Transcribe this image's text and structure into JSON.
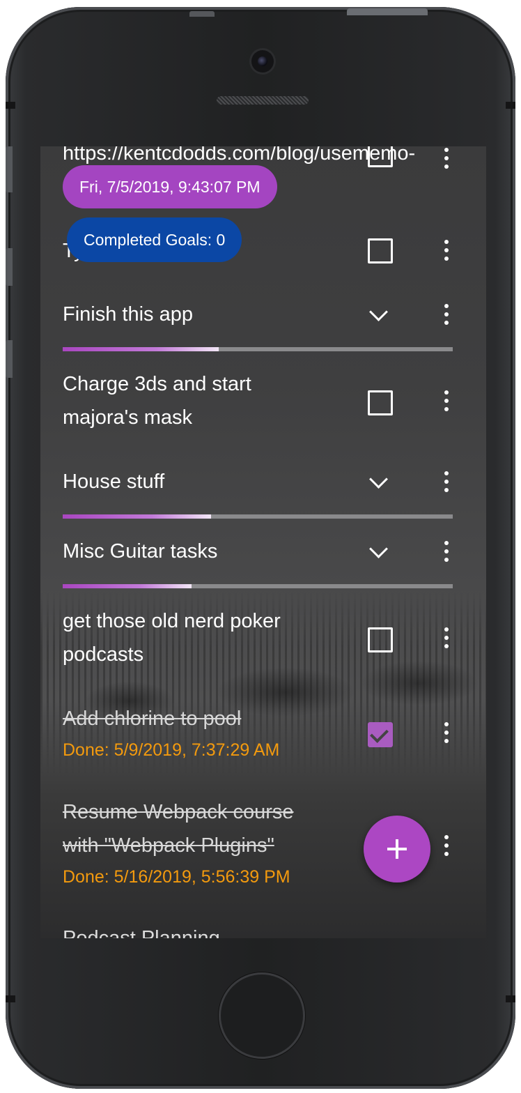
{
  "header": {
    "url_text": "https://kentcdodds.com/blog/usememo-",
    "timestamp": "Fri, 7/5/2019, 9:43:07 PM",
    "completed_goals": "Completed Goals: 0",
    "partial_title": "Ty"
  },
  "goals": [
    {
      "title": "Finish this app",
      "type": "group",
      "progress": 0.4
    },
    {
      "title_line1": "Charge 3ds and start",
      "title_line2": "majora's mask",
      "type": "task",
      "checked": false
    },
    {
      "title": "House stuff",
      "type": "group",
      "progress": 0.38
    },
    {
      "title": "Misc Guitar tasks",
      "type": "group",
      "progress": 0.33
    },
    {
      "title_line1": "get those old nerd poker",
      "title_line2": "podcasts",
      "type": "task",
      "checked": false
    },
    {
      "title": "Add chlorine to pool",
      "type": "task",
      "checked": true,
      "done": "Done: 5/9/2019, 7:37:29 AM"
    },
    {
      "title_line1": "Resume Webpack course",
      "title_line2": "with \"Webpack Plugins\"",
      "type": "task",
      "checked": true,
      "done": "Done: 5/16/2019, 5:56:39 PM"
    },
    {
      "title": "Podcast Planning",
      "type": "group"
    }
  ],
  "icons": {
    "more": "more-vert-icon",
    "expand": "chevron-down-icon",
    "add": "plus-icon"
  },
  "colors": {
    "accent": "#a445c1",
    "goals_badge": "#0b47a5",
    "done_text": "#f39a0e"
  }
}
